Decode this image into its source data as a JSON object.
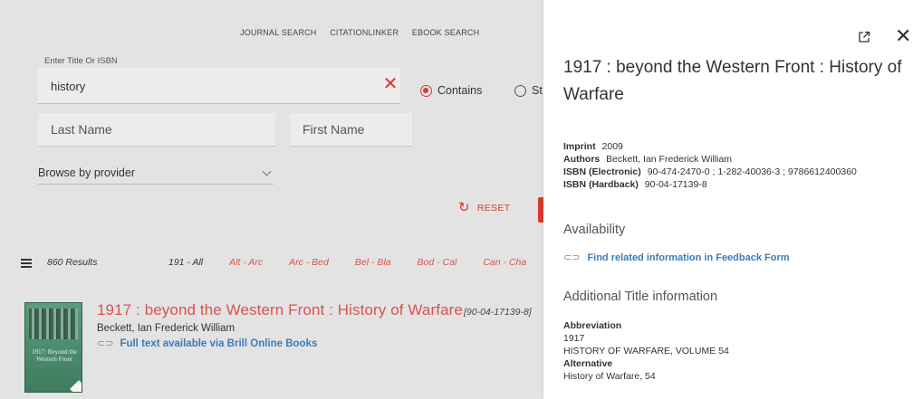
{
  "topnav": {
    "journal_search": "JOURNAL SEARCH",
    "citationlinker": "CITATIONLINKER",
    "ebook_search": "EBOOK SEARCH"
  },
  "search": {
    "title_label": "Enter Title Or ISBN",
    "title_value": "history",
    "clear_glyph": "✕",
    "radio_contains": "Contains",
    "radio_starts": "St",
    "last_name_placeholder": "Last Name",
    "first_name_placeholder": "First Name",
    "browse_label": "Browse by provider",
    "reset_label": "RESET",
    "reset_glyph": "↻"
  },
  "results": {
    "count": "860 Results",
    "ranges": [
      "191 - All",
      "Alt - Arc",
      "Arc - Bed",
      "Bel - Bla",
      "Bod - Cal",
      "Can - Cha"
    ],
    "items": [
      {
        "title": "1917 : beyond the Western Front : History of Warfare",
        "isbn": "[90-04-17139-8]",
        "author": "Beckett, Ian Frederick William",
        "link": "Full text available via Brill Online Books",
        "cover_text": "1917: Beyond the Western Front"
      }
    ]
  },
  "detail": {
    "title": "1917 : beyond the Western Front : History of Warfare",
    "imprint_label": "Imprint",
    "imprint_value": "2009",
    "authors_label": "Authors",
    "authors_value": "Beckett, Ian Frederick William",
    "isbn_e_label": "ISBN (Electronic)",
    "isbn_e_value": "90-474-2470-0 ; 1-282-40036-3 ; 9786612400360",
    "isbn_h_label": "ISBN (Hardback)",
    "isbn_h_value": "90-04-17139-8",
    "availability_heading": "Availability",
    "feedback_link": "Find related information in Feedback Form",
    "additional_heading": "Additional Title information",
    "abbreviation_label": "Abbreviation",
    "abbreviation_values": [
      "1917",
      "HISTORY OF WARFARE, VOLUME 54"
    ],
    "alternative_label": "Alternative",
    "alternative_value": "History of Warfare, 54",
    "close_glyph": "✕",
    "link_glyph": "⊂⊃"
  },
  "colors": {
    "accent": "#d93a2e",
    "link": "#3a7cb8",
    "overlay_bg": "#e3e3e3"
  }
}
